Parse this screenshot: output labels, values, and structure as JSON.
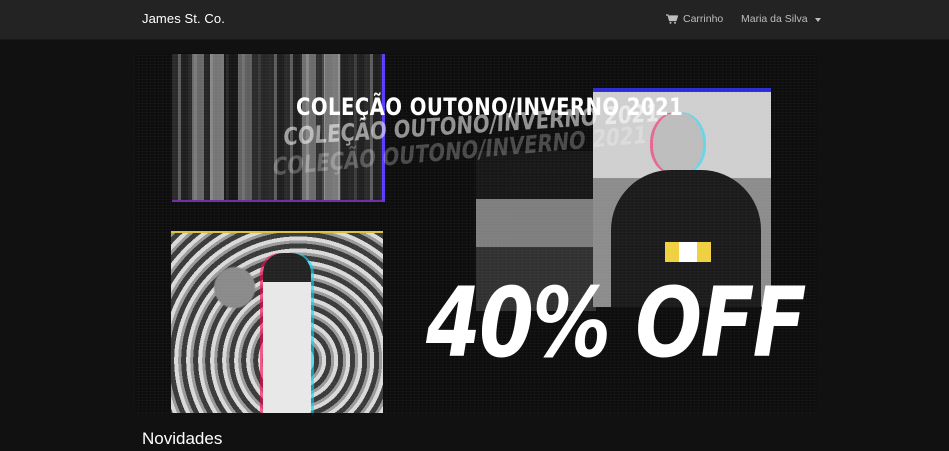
{
  "navbar": {
    "brand": "James St. Co.",
    "cart_label": "Carrinho",
    "user_label": "Maria da Silva"
  },
  "banner": {
    "title": "COLEÇÃO OUTONO/INVERNO 2021",
    "discount": "40% OFF"
  },
  "sections": {
    "new_arrivals_title": "Novidades"
  },
  "icons": {
    "cart": "cart-icon",
    "dropdown": "caret-down-icon"
  },
  "colors": {
    "navbar_bg": "#232323",
    "page_bg": "#111111",
    "text": "#ffffff",
    "nav_text": "#bdbdbd"
  }
}
